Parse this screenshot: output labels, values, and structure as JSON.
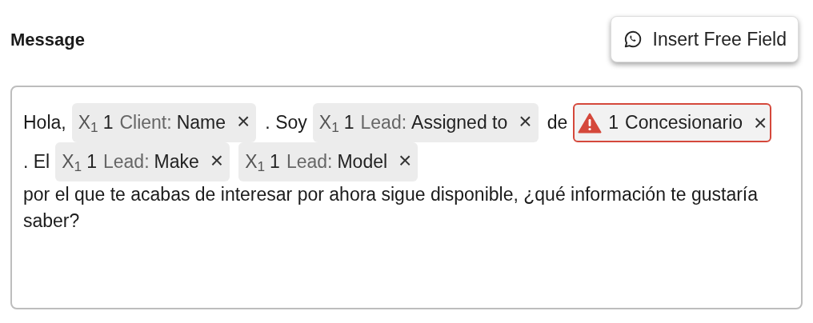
{
  "title": "Message",
  "insert_button": {
    "label": "Insert Free Field"
  },
  "segments": [
    {
      "kind": "text",
      "text": "Hola,"
    },
    {
      "kind": "variable",
      "prefix": "X$_{1}$",
      "count": "1",
      "category": "Client:",
      "field": "Name",
      "remove": "×"
    },
    {
      "kind": "text",
      "text": ". Soy"
    },
    {
      "kind": "variable",
      "prefix": "X$_{1}$",
      "count": "1",
      "category": "Lead:",
      "field": "Assigned to",
      "remove": "×"
    },
    {
      "kind": "text",
      "text": "de"
    },
    {
      "kind": "error",
      "count": "1",
      "field": "Concesionario",
      "remove": "×"
    },
    {
      "kind": "text",
      "text": ". El"
    },
    {
      "kind": "variable",
      "prefix": "X$_{1}$",
      "count": "1",
      "category": "Lead:",
      "field": "Make",
      "remove": "×"
    },
    {
      "kind": "variable",
      "prefix": "X$_{1}$",
      "count": "1",
      "category": "Lead:",
      "field": "Model",
      "remove": "×"
    },
    {
      "kind": "text",
      "text": "por el que te acabas de interesar por ahora sigue disponible, ¿qué información te gustaría saber?"
    }
  ]
}
